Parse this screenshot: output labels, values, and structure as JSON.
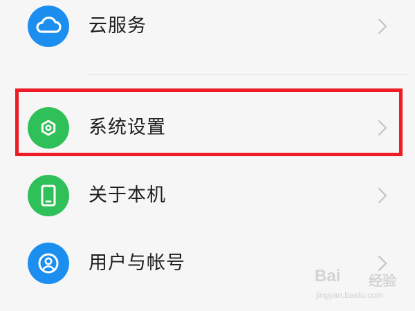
{
  "settings_list": {
    "items": [
      {
        "label": "云服务",
        "icon": "cloud-icon",
        "icon_color": "#1c8ef0"
      },
      {
        "label": "系统设置",
        "icon": "hexagon-settings-icon",
        "icon_color": "#2fc059",
        "highlighted": true
      },
      {
        "label": "关于本机",
        "icon": "phone-icon",
        "icon_color": "#2fc059"
      },
      {
        "label": "用户与帐号",
        "icon": "user-account-icon",
        "icon_color": "#1c8ef0"
      }
    ],
    "chevron_icon": "chevron-right-icon"
  },
  "highlight_color": "#ee1c25",
  "watermark": {
    "main": "Bai",
    "cn": "经验",
    "sub": "jingyan.baidu.com"
  }
}
